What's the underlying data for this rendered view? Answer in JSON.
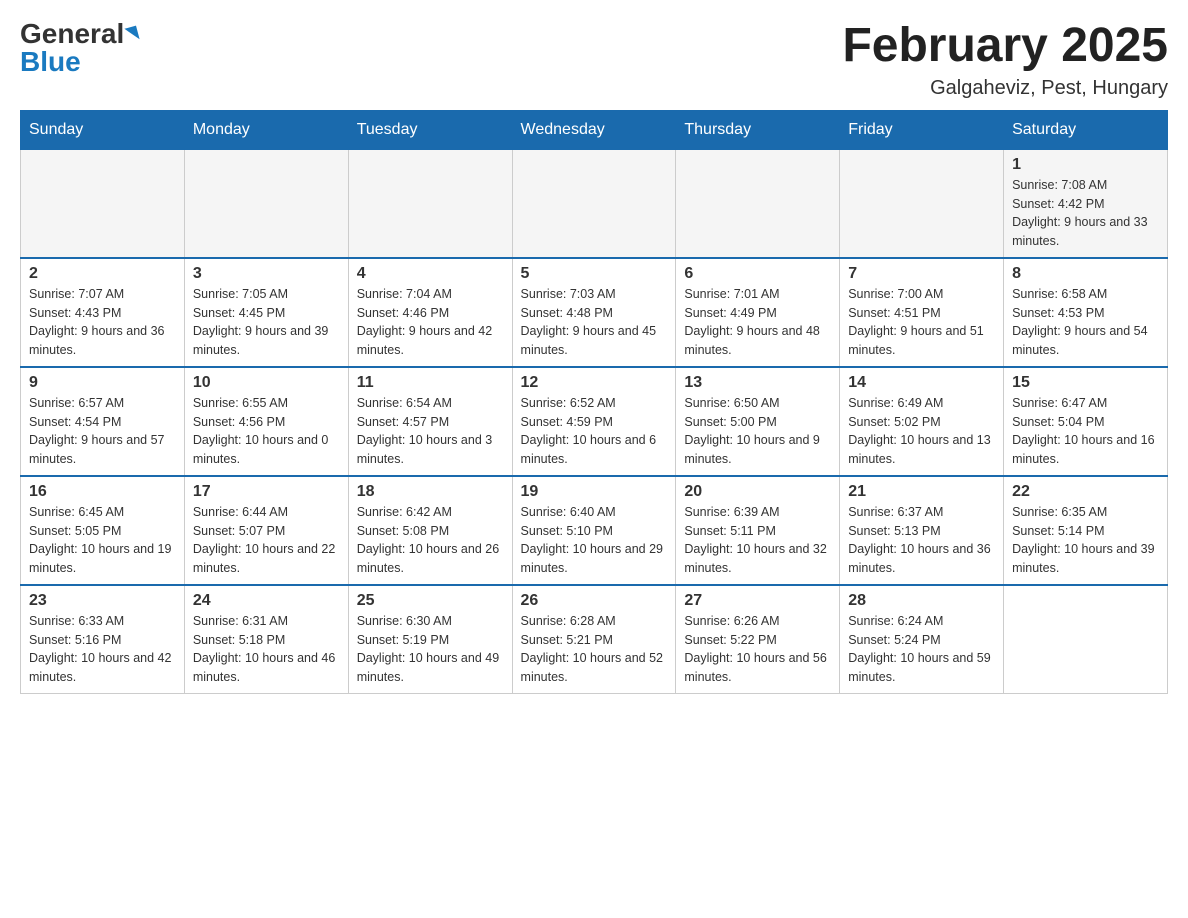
{
  "header": {
    "logo_general": "General",
    "logo_blue": "Blue",
    "title": "February 2025",
    "location": "Galgaheviz, Pest, Hungary"
  },
  "days_of_week": [
    "Sunday",
    "Monday",
    "Tuesday",
    "Wednesday",
    "Thursday",
    "Friday",
    "Saturday"
  ],
  "weeks": [
    [
      {
        "day": "",
        "info": ""
      },
      {
        "day": "",
        "info": ""
      },
      {
        "day": "",
        "info": ""
      },
      {
        "day": "",
        "info": ""
      },
      {
        "day": "",
        "info": ""
      },
      {
        "day": "",
        "info": ""
      },
      {
        "day": "1",
        "info": "Sunrise: 7:08 AM\nSunset: 4:42 PM\nDaylight: 9 hours and 33 minutes."
      }
    ],
    [
      {
        "day": "2",
        "info": "Sunrise: 7:07 AM\nSunset: 4:43 PM\nDaylight: 9 hours and 36 minutes."
      },
      {
        "day": "3",
        "info": "Sunrise: 7:05 AM\nSunset: 4:45 PM\nDaylight: 9 hours and 39 minutes."
      },
      {
        "day": "4",
        "info": "Sunrise: 7:04 AM\nSunset: 4:46 PM\nDaylight: 9 hours and 42 minutes."
      },
      {
        "day": "5",
        "info": "Sunrise: 7:03 AM\nSunset: 4:48 PM\nDaylight: 9 hours and 45 minutes."
      },
      {
        "day": "6",
        "info": "Sunrise: 7:01 AM\nSunset: 4:49 PM\nDaylight: 9 hours and 48 minutes."
      },
      {
        "day": "7",
        "info": "Sunrise: 7:00 AM\nSunset: 4:51 PM\nDaylight: 9 hours and 51 minutes."
      },
      {
        "day": "8",
        "info": "Sunrise: 6:58 AM\nSunset: 4:53 PM\nDaylight: 9 hours and 54 minutes."
      }
    ],
    [
      {
        "day": "9",
        "info": "Sunrise: 6:57 AM\nSunset: 4:54 PM\nDaylight: 9 hours and 57 minutes."
      },
      {
        "day": "10",
        "info": "Sunrise: 6:55 AM\nSunset: 4:56 PM\nDaylight: 10 hours and 0 minutes."
      },
      {
        "day": "11",
        "info": "Sunrise: 6:54 AM\nSunset: 4:57 PM\nDaylight: 10 hours and 3 minutes."
      },
      {
        "day": "12",
        "info": "Sunrise: 6:52 AM\nSunset: 4:59 PM\nDaylight: 10 hours and 6 minutes."
      },
      {
        "day": "13",
        "info": "Sunrise: 6:50 AM\nSunset: 5:00 PM\nDaylight: 10 hours and 9 minutes."
      },
      {
        "day": "14",
        "info": "Sunrise: 6:49 AM\nSunset: 5:02 PM\nDaylight: 10 hours and 13 minutes."
      },
      {
        "day": "15",
        "info": "Sunrise: 6:47 AM\nSunset: 5:04 PM\nDaylight: 10 hours and 16 minutes."
      }
    ],
    [
      {
        "day": "16",
        "info": "Sunrise: 6:45 AM\nSunset: 5:05 PM\nDaylight: 10 hours and 19 minutes."
      },
      {
        "day": "17",
        "info": "Sunrise: 6:44 AM\nSunset: 5:07 PM\nDaylight: 10 hours and 22 minutes."
      },
      {
        "day": "18",
        "info": "Sunrise: 6:42 AM\nSunset: 5:08 PM\nDaylight: 10 hours and 26 minutes."
      },
      {
        "day": "19",
        "info": "Sunrise: 6:40 AM\nSunset: 5:10 PM\nDaylight: 10 hours and 29 minutes."
      },
      {
        "day": "20",
        "info": "Sunrise: 6:39 AM\nSunset: 5:11 PM\nDaylight: 10 hours and 32 minutes."
      },
      {
        "day": "21",
        "info": "Sunrise: 6:37 AM\nSunset: 5:13 PM\nDaylight: 10 hours and 36 minutes."
      },
      {
        "day": "22",
        "info": "Sunrise: 6:35 AM\nSunset: 5:14 PM\nDaylight: 10 hours and 39 minutes."
      }
    ],
    [
      {
        "day": "23",
        "info": "Sunrise: 6:33 AM\nSunset: 5:16 PM\nDaylight: 10 hours and 42 minutes."
      },
      {
        "day": "24",
        "info": "Sunrise: 6:31 AM\nSunset: 5:18 PM\nDaylight: 10 hours and 46 minutes."
      },
      {
        "day": "25",
        "info": "Sunrise: 6:30 AM\nSunset: 5:19 PM\nDaylight: 10 hours and 49 minutes."
      },
      {
        "day": "26",
        "info": "Sunrise: 6:28 AM\nSunset: 5:21 PM\nDaylight: 10 hours and 52 minutes."
      },
      {
        "day": "27",
        "info": "Sunrise: 6:26 AM\nSunset: 5:22 PM\nDaylight: 10 hours and 56 minutes."
      },
      {
        "day": "28",
        "info": "Sunrise: 6:24 AM\nSunset: 5:24 PM\nDaylight: 10 hours and 59 minutes."
      },
      {
        "day": "",
        "info": ""
      }
    ]
  ]
}
